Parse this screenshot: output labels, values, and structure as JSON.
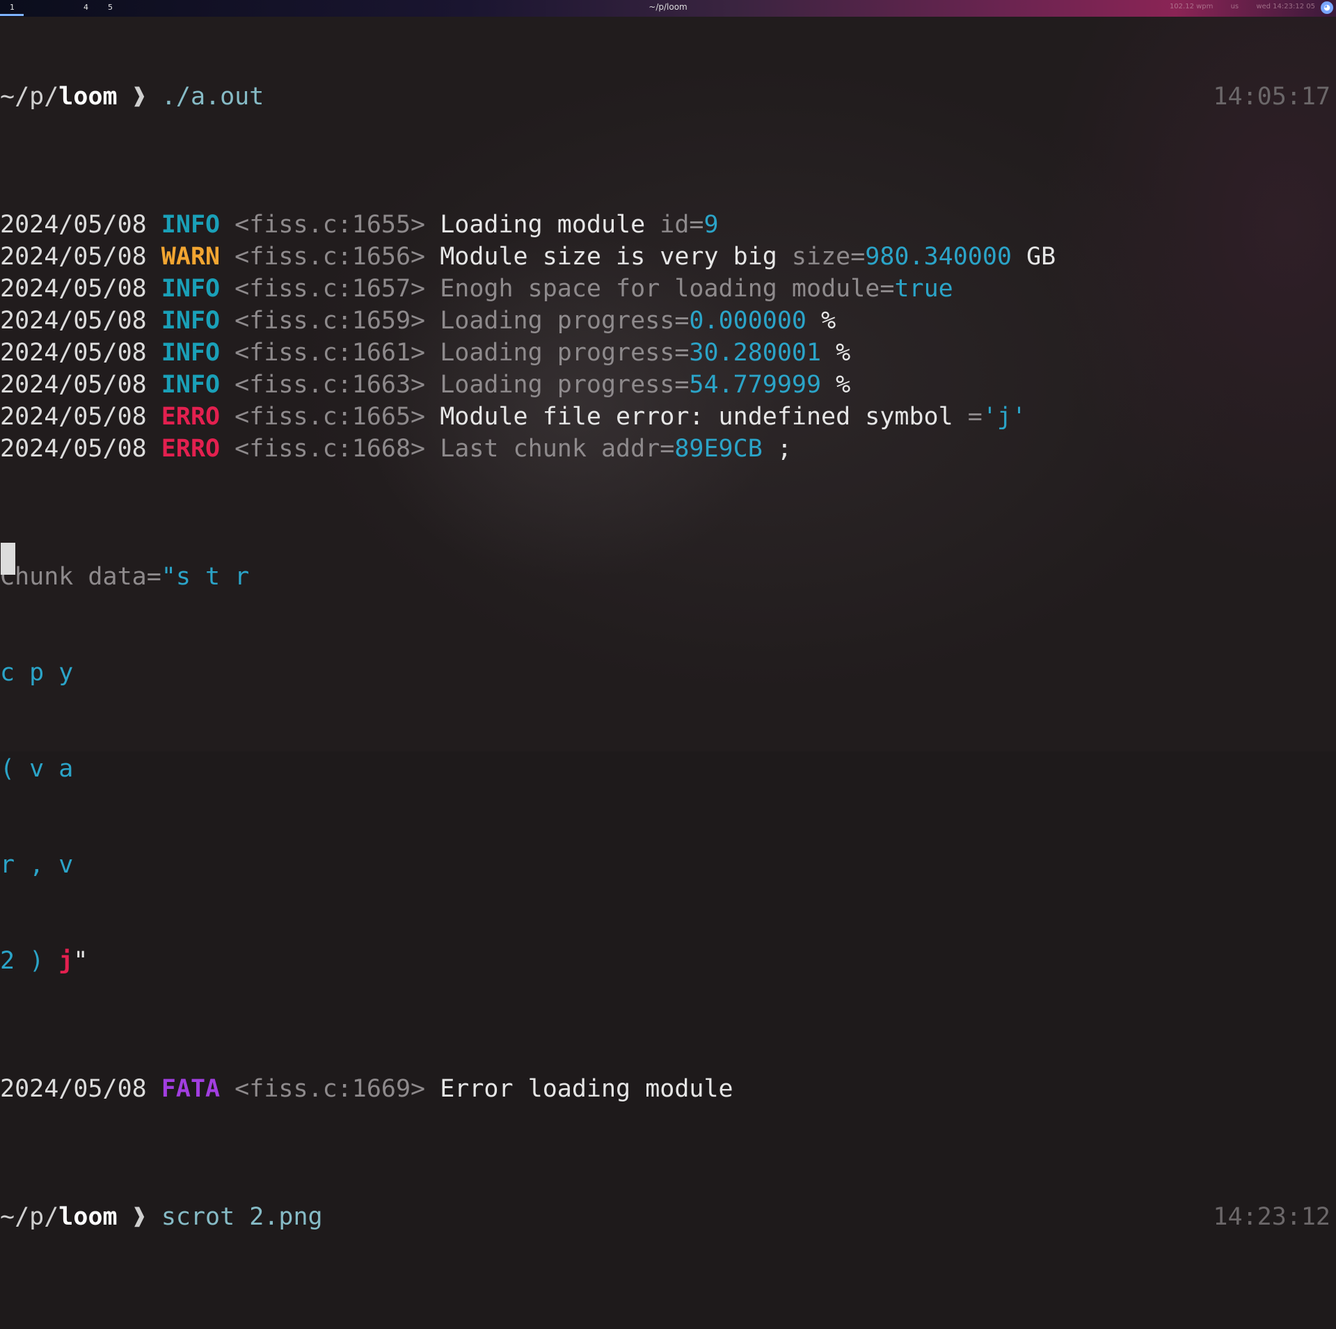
{
  "topbar": {
    "workspaces": [
      "1",
      "4",
      "5"
    ],
    "window_title": "~/p/loom",
    "tray": [
      "102.12 wpm",
      "us",
      "wed 14:23:12 05"
    ],
    "tray_icon": "discord-icon"
  },
  "terminal": {
    "prompt1": {
      "path_prefix": "~/p/",
      "path_dir": "loom",
      "arrow": "❱",
      "command": "./a.out",
      "time": "14:05:17"
    },
    "logs": [
      {
        "date": "2024/05/08",
        "level": "INFO",
        "src": "<fiss.c:1655>",
        "parts": [
          [
            "bright",
            "Loading module "
          ],
          [
            "dim",
            "id="
          ],
          [
            "val",
            "9"
          ]
        ]
      },
      {
        "date": "2024/05/08",
        "level": "WARN",
        "src": "<fiss.c:1656>",
        "parts": [
          [
            "bright",
            "Module size is very big "
          ],
          [
            "dim",
            "size="
          ],
          [
            "val",
            "980.340000"
          ],
          [
            "unit",
            " GB"
          ]
        ]
      },
      {
        "date": "2024/05/08",
        "level": "INFO",
        "src": "<fiss.c:1657>",
        "parts": [
          [
            "dim",
            "Enogh space for loading "
          ],
          [
            "dim",
            "module="
          ],
          [
            "val",
            "true"
          ]
        ]
      },
      {
        "date": "2024/05/08",
        "level": "INFO",
        "src": "<fiss.c:1659>",
        "parts": [
          [
            "dim",
            "Loading "
          ],
          [
            "dim",
            "progress="
          ],
          [
            "val",
            "0.000000"
          ],
          [
            "unit",
            " %"
          ]
        ]
      },
      {
        "date": "2024/05/08",
        "level": "INFO",
        "src": "<fiss.c:1661>",
        "parts": [
          [
            "dim",
            "Loading "
          ],
          [
            "dim",
            "progress="
          ],
          [
            "val",
            "30.280001"
          ],
          [
            "unit",
            " %"
          ]
        ]
      },
      {
        "date": "2024/05/08",
        "level": "INFO",
        "src": "<fiss.c:1663>",
        "parts": [
          [
            "dim",
            "Loading "
          ],
          [
            "dim",
            "progress="
          ],
          [
            "val",
            "54.779999"
          ],
          [
            "unit",
            " %"
          ]
        ]
      },
      {
        "date": "2024/05/08",
        "level": "ERRO",
        "src": "<fiss.c:1665>",
        "parts": [
          [
            "bright",
            "Module file error: undefined symbol "
          ],
          [
            "dim",
            "="
          ],
          [
            "val",
            "'j'"
          ]
        ]
      },
      {
        "date": "2024/05/08",
        "level": "ERRO",
        "src": "<fiss.c:1668>",
        "parts": [
          [
            "dim",
            "Last chunk "
          ],
          [
            "dim",
            "addr="
          ],
          [
            "val",
            "89E9CB"
          ],
          [
            "unit",
            " ;"
          ]
        ]
      }
    ],
    "chunk": {
      "label": "Chunk data=",
      "lines": [
        "\"s t r",
        "c p y",
        "( v a",
        "r , v",
        "2 ) "
      ],
      "red_char": "j",
      "close_quote": "\""
    },
    "fatal": {
      "date": "2024/05/08",
      "level": "FATA",
      "src": "<fiss.c:1669>",
      "message": "Error loading module"
    },
    "prompt2": {
      "path_prefix": "~/p/",
      "path_dir": "loom",
      "arrow": "❱",
      "command": "scrot 2.png",
      "time": "14:23:12"
    }
  }
}
